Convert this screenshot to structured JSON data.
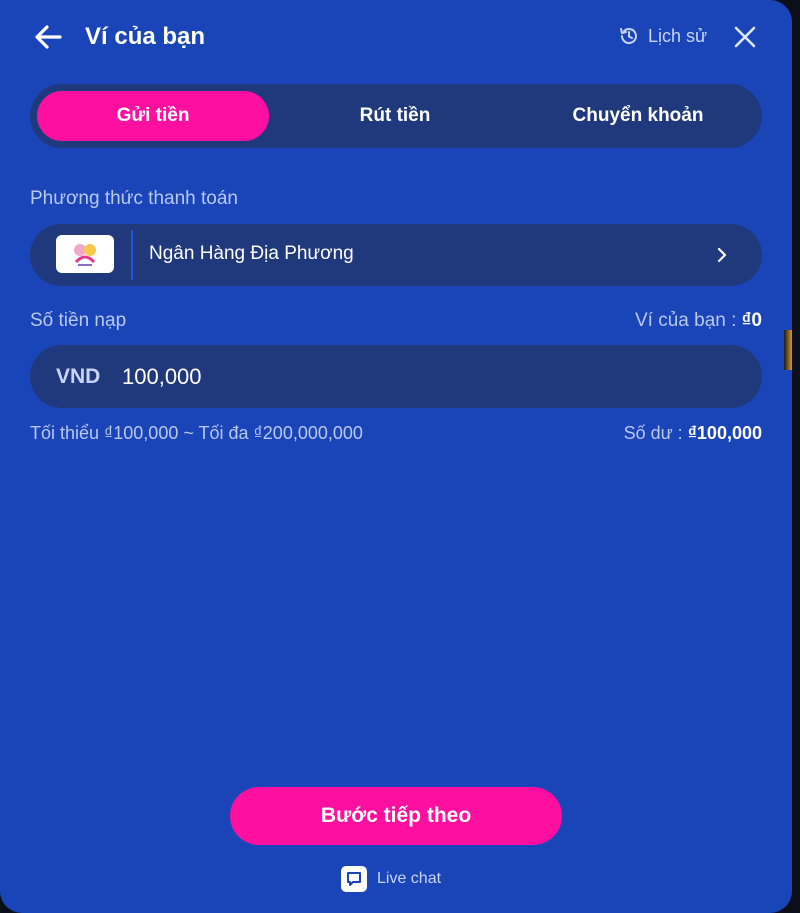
{
  "header": {
    "title": "Ví của bạn",
    "history_label": "Lịch sử",
    "back_icon": "arrow-left-icon",
    "history_icon": "history-icon",
    "close_icon": "close-icon"
  },
  "tabs": [
    {
      "label": "Gửi tiền",
      "active": true
    },
    {
      "label": "Rút tiền",
      "active": false
    },
    {
      "label": "Chuyển khoản",
      "active": false
    }
  ],
  "payment": {
    "label": "Phương thức thanh toán",
    "method_name": "Ngân Hàng Địa Phương",
    "chevron_icon": "chevron-right-icon"
  },
  "amount": {
    "label": "Số tiền nạp",
    "wallet_label": "Ví của bạn :",
    "wallet_value": "₫0",
    "currency": "VND",
    "value": "100,000",
    "limits": "Tối thiểu ₫100,000 ~ Tối đa ₫200,000,000",
    "balance_label": "Số dư :",
    "balance_value": "₫100,000"
  },
  "actions": {
    "next_label": "Bước tiếp theo",
    "live_chat_label": "Live chat",
    "chat_icon": "chat-icon"
  },
  "colors": {
    "background": "#1a45b8",
    "panel": "#20397d",
    "accent": "#ff0fa0",
    "muted_text": "#b9c8f0"
  }
}
